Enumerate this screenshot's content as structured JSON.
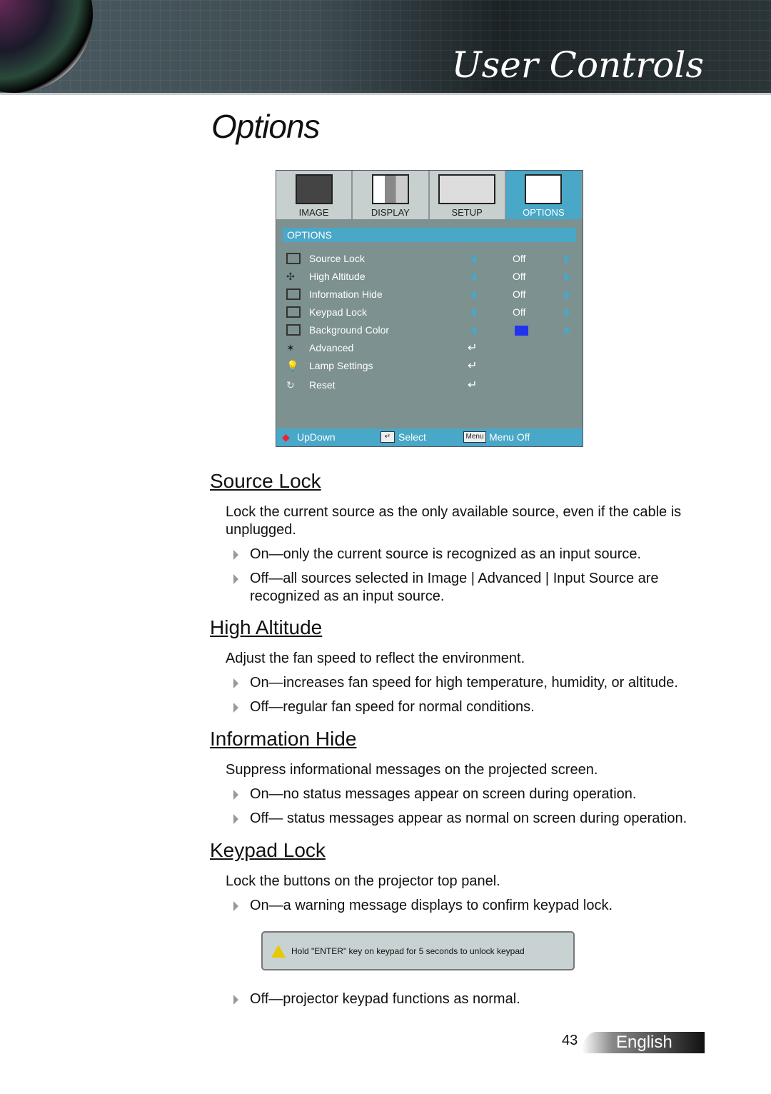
{
  "header": {
    "title": "User Controls"
  },
  "page_title": "Options",
  "menu": {
    "tabs": [
      {
        "label": "IMAGE"
      },
      {
        "label": "DISPLAY"
      },
      {
        "label": "SETUP"
      },
      {
        "label": "OPTIONS",
        "active": true
      }
    ],
    "section": "OPTIONS",
    "items": [
      {
        "label": "Source Lock",
        "value": "Off",
        "icon": "source-lock-icon"
      },
      {
        "label": "High Altitude",
        "value": "Off",
        "icon": "fan-icon"
      },
      {
        "label": "Information Hide",
        "value": "Off",
        "icon": "info-hide-icon"
      },
      {
        "label": "Keypad Lock",
        "value": "Off",
        "icon": "keypad-icon"
      },
      {
        "label": "Background Color",
        "value_color": "#2233ee",
        "icon": "background-icon"
      },
      {
        "label": "Advanced",
        "icon": "advanced-icon"
      },
      {
        "label": "Lamp Settings",
        "icon": "lamp-icon"
      },
      {
        "label": "Reset",
        "icon": "reset-icon"
      }
    ],
    "footer": {
      "updown": "UpDown",
      "select": "Select",
      "menu_key": "Menu",
      "menu_off": "Menu Off"
    },
    "accent": "#49a7c8"
  },
  "sections": [
    {
      "title": "Source Lock",
      "desc": "Lock the current source as the only available source, even if the cable is unplugged.",
      "bullets": [
        "On—only the current source is recognized as an input source.",
        "Off—all sources selected in Image | Advanced | Input Source are recognized as an input source."
      ]
    },
    {
      "title": "High Altitude",
      "desc": "Adjust the fan speed to reflect the environment.",
      "bullets": [
        "On—increases fan speed for high temperature, humidity, or altitude.",
        "Off—regular fan speed for normal conditions."
      ]
    },
    {
      "title": "Information Hide",
      "desc": "Suppress informational messages on the projected screen.",
      "bullets": [
        "On—no status messages appear on screen during operation.",
        "Off— status messages appear as normal on screen during operation."
      ]
    },
    {
      "title": "Keypad Lock",
      "desc": "Lock the buttons on the projector top panel.",
      "bullets": [
        "On—a warning message displays to confirm keypad lock.",
        "Off—projector keypad functions as normal."
      ]
    }
  ],
  "warning": "Hold \"ENTER\" key on keypad for 5 seconds to unlock keypad",
  "footer": {
    "page": "43",
    "language": "English"
  }
}
